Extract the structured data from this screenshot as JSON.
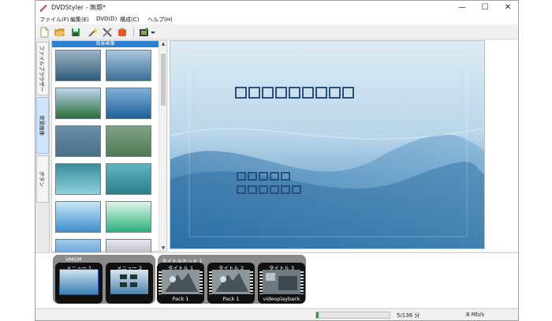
{
  "window": {
    "title": "DVDStyler - 無題*",
    "minimize": "—",
    "maximize": "☐",
    "close": "✕"
  },
  "menu": [
    "ファイル(F)",
    "編集(E)",
    "DVD(D)",
    "構成(C)",
    "ヘルプ(H)"
  ],
  "toolbar": {
    "icons": [
      "new-file-icon",
      "open-folder-icon",
      "save-icon",
      "burn-wand-icon",
      "settings-tools-icon",
      "render-icon",
      "add-video-icon",
      "dropdown-arrow-icon"
    ]
  },
  "side_tabs": [
    "ファイルブラウザー",
    "背景画像",
    "ボタン"
  ],
  "background_browser": {
    "header": "背景画像",
    "scroll_up": "▲",
    "scroll_down": "▼",
    "thumbnails": [
      {
        "name": "thumb-sea-1",
        "colors": [
          "#9db4c8",
          "#2f5b7a"
        ]
      },
      {
        "name": "thumb-sea-2",
        "colors": [
          "#a9c5df",
          "#3c6f95"
        ]
      },
      {
        "name": "thumb-coast",
        "colors": [
          "#bcd6ea",
          "#2a6d3a"
        ]
      },
      {
        "name": "thumb-blue-wave",
        "colors": [
          "#7fb0d6",
          "#1f5f98"
        ]
      },
      {
        "name": "thumb-teal-blur",
        "colors": [
          "#6c8fa8",
          "#4a6f89"
        ]
      },
      {
        "name": "thumb-green-blur",
        "colors": [
          "#7fa284",
          "#4f7b55"
        ]
      },
      {
        "name": "thumb-teal-band",
        "colors": [
          "#3a8c9c",
          "#8fd0da"
        ]
      },
      {
        "name": "thumb-aqua",
        "colors": [
          "#5fb5c0",
          "#2c7e8a"
        ]
      },
      {
        "name": "thumb-lightblue-frame",
        "colors": [
          "#c9e6f5",
          "#3d8fd0"
        ]
      },
      {
        "name": "thumb-mint-frame",
        "colors": [
          "#dff5ea",
          "#2bb07a"
        ]
      },
      {
        "name": "thumb-blue-stripes",
        "colors": [
          "#9ec9ea",
          "#2f7fc3"
        ]
      },
      {
        "name": "thumb-gray-gradient",
        "colors": [
          "#e6e6ea",
          "#8f8fa0"
        ]
      }
    ]
  },
  "canvas": {
    "title_glyph_count": 9,
    "button_row1_count": 5,
    "button_row2_count": 6
  },
  "timeline": {
    "vmgm_group": "VMGM",
    "titleset_group": "タイトルセット 1",
    "items": [
      {
        "label": "メニュー 1",
        "sub": ""
      },
      {
        "label": "メニュー 2",
        "sub": ""
      },
      {
        "label": "タイトル 1",
        "sub": "Pack 1"
      },
      {
        "label": "タイトル 2",
        "sub": "Pack 1"
      },
      {
        "label": "タイトル 3",
        "sub": "videoplayback"
      }
    ]
  },
  "status": {
    "progress_fraction": 0.037,
    "progress_color": "#1fa33a",
    "duration": "5/136 分",
    "bitrate": "8 Mb/s"
  },
  "colors": {
    "accent": "#2f7fd2",
    "canvas_top": "#dfeef7",
    "canvas_bottom": "#2e7cb4"
  }
}
